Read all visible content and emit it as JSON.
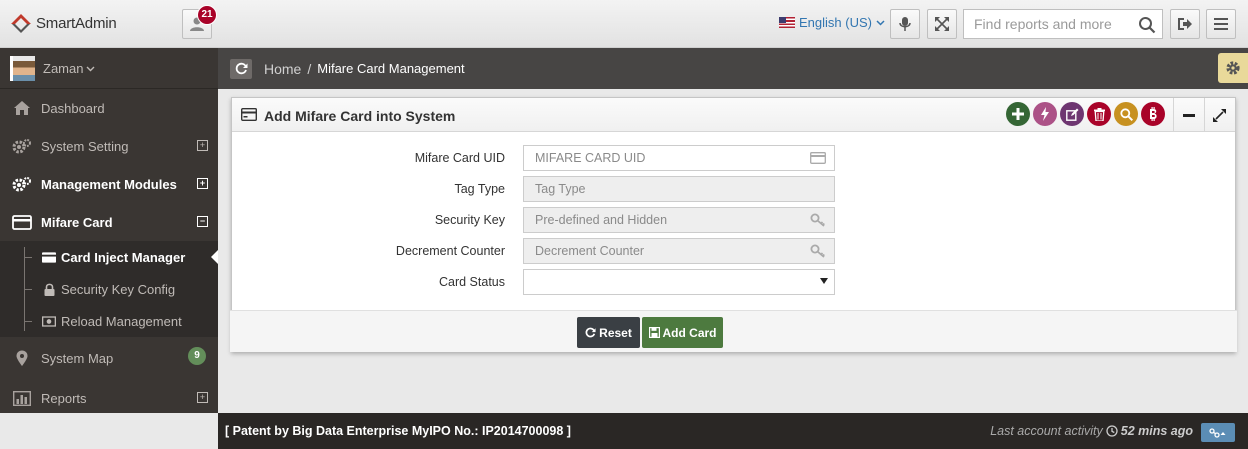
{
  "header": {
    "app_name": "SmartAdmin",
    "activity_count": "21",
    "language": "English (US)",
    "search_placeholder": "Find reports and more"
  },
  "sidebar": {
    "user_name": "Zaman",
    "items": [
      {
        "label": "Dashboard",
        "icon": "home-icon"
      },
      {
        "label": "System Setting",
        "icon": "gears-icon"
      },
      {
        "label": "Management Modules",
        "icon": "gears-icon"
      },
      {
        "label": "Mifare Card",
        "icon": "credit-card-icon"
      }
    ],
    "sub_items": [
      {
        "label": "Card Inject Manager",
        "icon": "credit-card-icon"
      },
      {
        "label": "Security Key Config",
        "icon": "lock-icon"
      },
      {
        "label": "Reload Management",
        "icon": "money-icon"
      }
    ],
    "bottom_items": [
      {
        "label": "System Map",
        "icon": "map-marker-icon",
        "badge": "9"
      },
      {
        "label": "Reports",
        "icon": "bar-chart-icon"
      }
    ]
  },
  "breadcrumb": {
    "home": "Home",
    "separator": "/",
    "current": "Mifare Card Management"
  },
  "widget": {
    "title": "Add Mifare Card into System",
    "fields": [
      {
        "label": "Mifare Card UID",
        "placeholder": "MIFARE CARD UID"
      },
      {
        "label": "Tag Type",
        "placeholder": "Tag Type"
      },
      {
        "label": "Security Key",
        "placeholder": "Pre-defined and Hidden"
      },
      {
        "label": "Decrement Counter",
        "placeholder": "Decrement Counter"
      },
      {
        "label": "Card Status",
        "value": ""
      }
    ],
    "reset_label": "Reset",
    "add_label": "Add Card"
  },
  "footer": {
    "left_text": "[ Patent by Big Data Enterprise  MyIPO No.: IP2014700098 ]",
    "activity_label": "Last account activity",
    "activity_time": "52 mins ago"
  },
  "colors": {
    "sidebar_bg": "#3a3633",
    "ribbon_bg": "#474544",
    "badge_red": "#a90329",
    "badge_green": "#638e5a",
    "link_blue": "#3276b1",
    "reset_btn": "#3a3f44",
    "add_btn": "#4d7a3f"
  }
}
